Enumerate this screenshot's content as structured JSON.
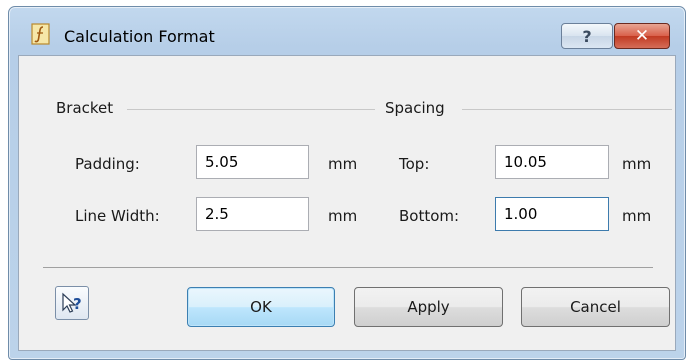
{
  "window": {
    "title": "Calculation Format"
  },
  "titlebar_buttons": {
    "help": "?",
    "close": "✕"
  },
  "bracket": {
    "heading": "Bracket",
    "padding_label": "Padding:",
    "padding_value": "5.05",
    "padding_unit": "mm",
    "line_width_label": "Line Width:",
    "line_width_value": "2.5",
    "line_width_unit": "mm"
  },
  "spacing": {
    "heading": "Spacing",
    "top_label": "Top:",
    "top_value": "10.05",
    "top_unit": "mm",
    "bottom_label": "Bottom:",
    "bottom_value": "1.00",
    "bottom_unit": "mm"
  },
  "buttons": {
    "ok": "OK",
    "apply": "Apply",
    "cancel": "Cancel"
  },
  "colors": {
    "frame": "#bcd3ea",
    "client": "#f0f0f0",
    "default_button": "#bee6fd",
    "close_button": "#c13a22"
  }
}
